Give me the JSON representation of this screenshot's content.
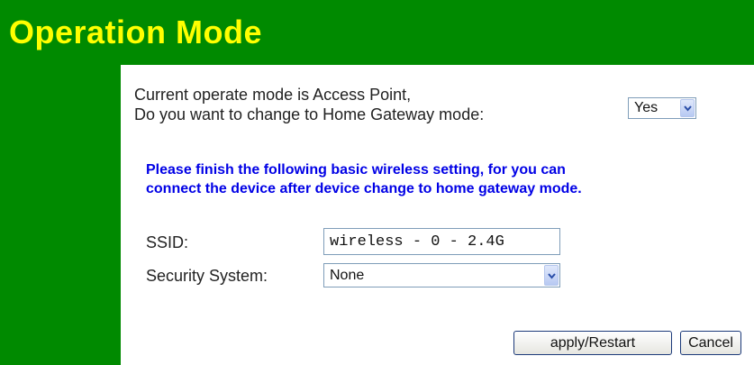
{
  "header": {
    "title": "Operation Mode"
  },
  "mode": {
    "line1": "Current operate mode is Access Point,",
    "line2": "Do you want to change to Home Gateway mode:",
    "change_select_value": "Yes"
  },
  "notice": "Please finish the following basic wireless setting, for you can connect the device after device change to home gateway mode.",
  "form": {
    "ssid_label": "SSID:",
    "ssid_value": "wireless - 0 - 2.4G",
    "security_label": "Security System:",
    "security_value": "None"
  },
  "buttons": {
    "apply": "apply/Restart",
    "cancel": "Cancel"
  },
  "colors": {
    "header_bg": "#008a00",
    "title": "#ffff00",
    "notice": "#0000e6"
  },
  "icons": {
    "dropdown": "chevron-down-icon"
  }
}
